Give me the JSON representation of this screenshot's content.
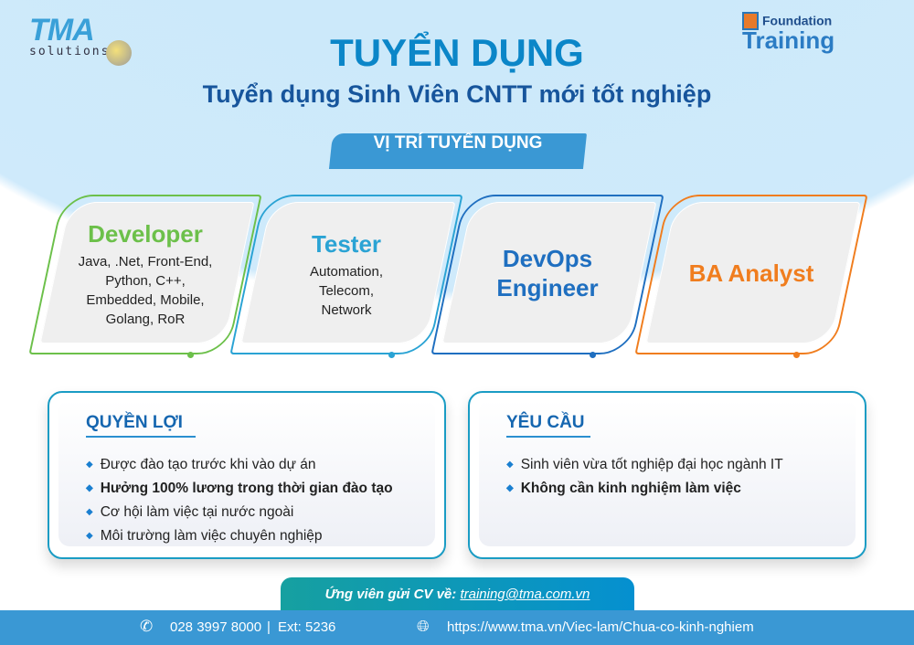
{
  "header": {
    "logo_left": "TMA solutions",
    "logo_right_line1": "Foundation",
    "logo_right_line2": "Training",
    "title": "TUYỂN DỤNG",
    "subtitle": "Tuyển dụng Sinh Viên CNTT mới tốt nghiệp",
    "positions_label": "VỊ TRÍ TUYỂN DỤNG"
  },
  "positions": [
    {
      "name": "Developer",
      "detail": [
        "Java, .Net, Front-End,",
        "Python, C++,",
        "Embedded, Mobile,",
        "Golang, RoR"
      ],
      "color": "#6cc04a"
    },
    {
      "name": "Tester",
      "detail": [
        "Automation,",
        "Telecom,",
        "Network"
      ],
      "color": "#2aa3d4"
    },
    {
      "name": "DevOps Engineer",
      "detail": [],
      "color": "#1f6fc0"
    },
    {
      "name": "BA Analyst",
      "detail": [],
      "color": "#f07d1e"
    }
  ],
  "benefits": {
    "title": "QUYỀN LỢI",
    "items": [
      "Được đào tạo trước khi vào dự án",
      "Hưởng 100% lương trong thời gian đào tạo",
      "Cơ hội làm việc tại nước ngoài",
      "Môi trường làm việc chuyên nghiệp"
    ]
  },
  "requirements": {
    "title": "YÊU CẦU",
    "items": [
      "Sinh viên vừa tốt nghiệp đại học ngành IT",
      "Không cần kinh nghiệm làm việc"
    ]
  },
  "apply": {
    "label": "Ứng viên gửi CV về:",
    "email": "training@tma.com.vn"
  },
  "footer": {
    "phone": "028 3997 8000",
    "ext": "Ext: 5236",
    "url": "https://www.tma.vn/Viec-lam/Chua-co-kinh-nghiem",
    "phone_icon": "phone-icon",
    "web_icon": "globe-icon"
  }
}
